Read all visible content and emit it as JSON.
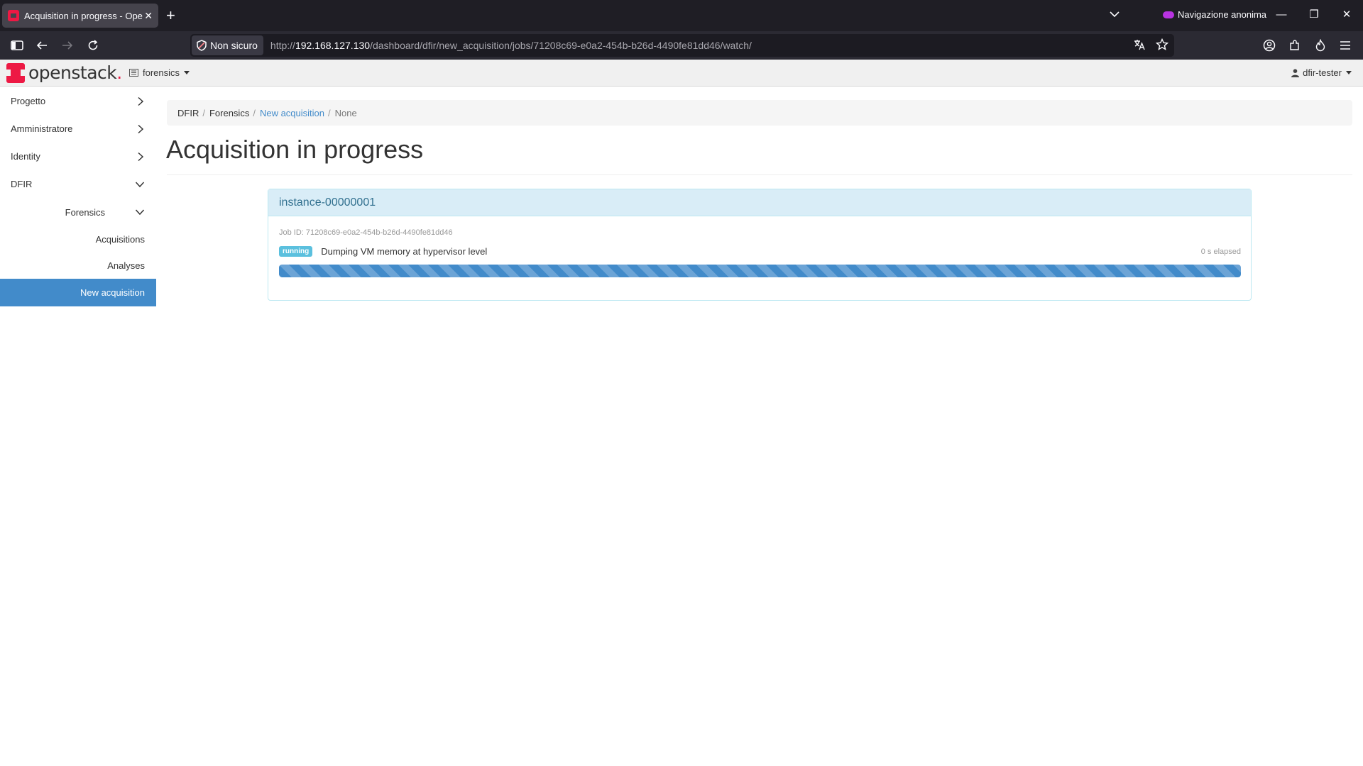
{
  "browser": {
    "tab_title": "Acquisition in progress - OpenStack Dashboard",
    "tab_close": "✕",
    "new_tab": "+",
    "private_label": "Navigazione anonima",
    "security_label": "Non sicuro",
    "url_prefix": "http://",
    "url_host": "192.168.127.130",
    "url_path": "/dashboard/dfir/new_acquisition/jobs/71208c69-e0a2-454b-b26d-4490fe81dd46/watch/"
  },
  "header": {
    "logo_text": "openstack",
    "logo_dot": ".",
    "project": "forensics",
    "user": "dfir-tester"
  },
  "sidebar": {
    "items": [
      {
        "label": "Progetto"
      },
      {
        "label": "Amministratore"
      },
      {
        "label": "Identity"
      },
      {
        "label": "DFIR"
      }
    ],
    "sub": {
      "label": "Forensics"
    },
    "leaves": [
      {
        "label": "Acquisitions"
      },
      {
        "label": "Analyses"
      }
    ],
    "active": {
      "label": "New acquisition"
    }
  },
  "breadcrumb": {
    "items": [
      "DFIR",
      "Forensics",
      "New acquisition",
      "None"
    ],
    "separator": "/"
  },
  "page": {
    "title": "Acquisition in progress"
  },
  "job": {
    "instance": "instance-00000001",
    "job_id_text": "Job ID: 71208c69-e0a2-454b-b26d-4490fe81dd46",
    "status": "running",
    "status_text": "Dumping VM memory at hypervisor level",
    "elapsed": "0 s elapsed",
    "progress": 1.0
  },
  "colors": {
    "accent": "#428bca",
    "badge": "#5bc0de",
    "panel_heading": "#d9edf7",
    "brand": "#ed1944"
  }
}
